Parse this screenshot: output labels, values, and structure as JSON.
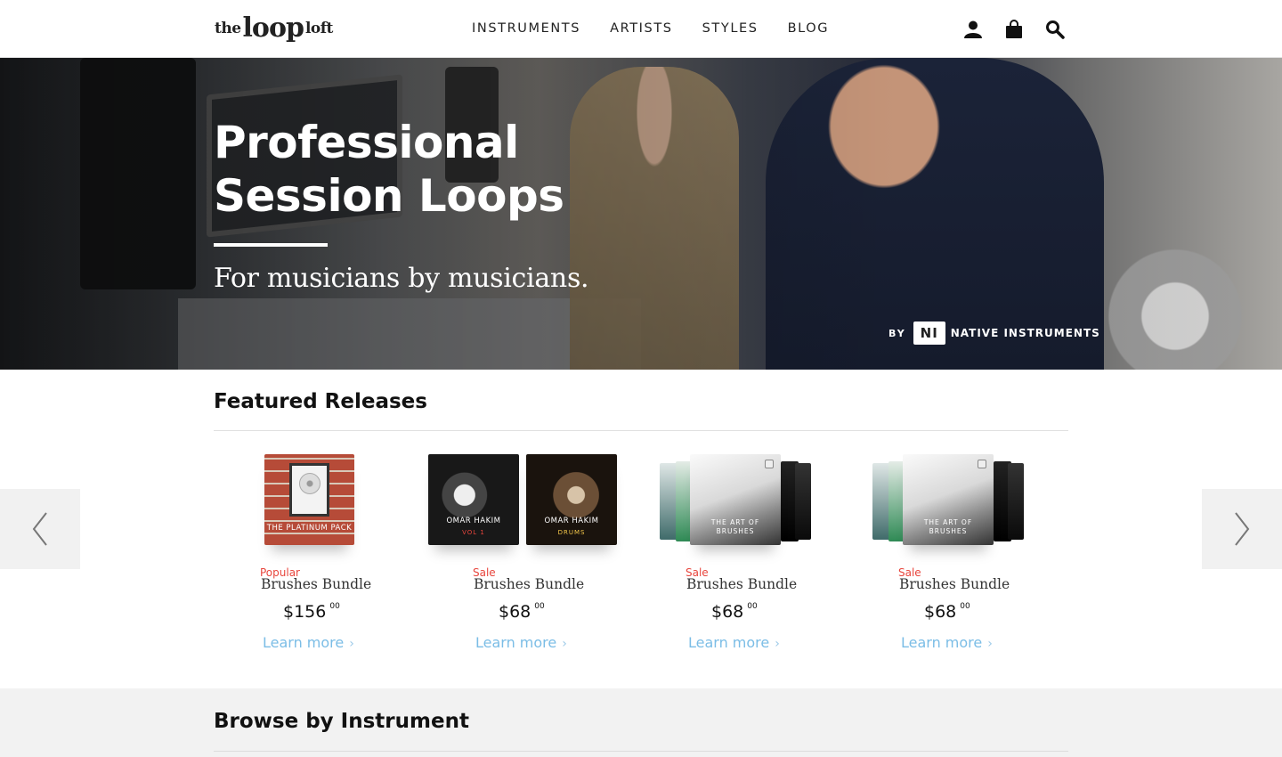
{
  "header": {
    "logo": {
      "the": "the",
      "loop": "loop",
      "loft": "loft"
    },
    "nav": [
      "INSTRUMENTS",
      "ARTISTS",
      "STYLES",
      "BLOG"
    ],
    "icons": [
      "account-icon",
      "cart-icon",
      "search-icon"
    ]
  },
  "hero": {
    "title_line1": "Professional",
    "title_line2": "Session Loops",
    "subtitle": "For musicians by musicians.",
    "ni_by": "BY",
    "ni_mark": "NI",
    "ni_brand": "NATIVE INSTRUMENTS"
  },
  "featured": {
    "title": "Featured Releases",
    "products": [
      {
        "tag": "Popular",
        "name": "Brushes Bundle",
        "price": "$156",
        "cents": "00",
        "link": "Learn more",
        "art": "THE PLATINUM PACK"
      },
      {
        "tag": "Sale",
        "name": "Brushes Bundle",
        "price": "$68",
        "cents": "00",
        "link": "Learn more",
        "art1": "OMAR HAKIM",
        "art1_sub": "VOL 1",
        "art2": "OMAR HAKIM",
        "art2_sub": "DRUMS"
      },
      {
        "tag": "Sale",
        "name": "Brushes Bundle",
        "price": "$68",
        "cents": "00",
        "link": "Learn more",
        "art_l1": "THE ART OF",
        "art_l2": "BRUSHES"
      },
      {
        "tag": "Sale",
        "name": "Brushes Bundle",
        "price": "$68",
        "cents": "00",
        "link": "Learn more",
        "art_l1": "THE ART OF",
        "art_l2": "BRUSHES"
      }
    ]
  },
  "browse": {
    "title": "Browse by Instrument"
  },
  "colors": {
    "sale": "#e8453c",
    "link": "#7bbde6",
    "panel": "#f2f2f2"
  }
}
